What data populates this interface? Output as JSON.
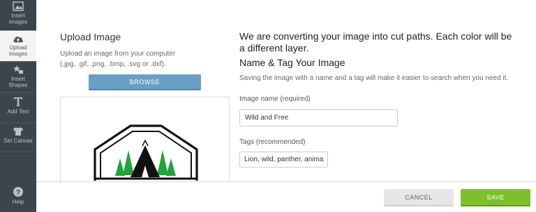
{
  "sidebar": {
    "items": [
      {
        "label": "Insert\nImages",
        "icon": "image-icon"
      },
      {
        "label": "Upload\nImages",
        "icon": "cloud-upload-icon",
        "active": true
      },
      {
        "label": "Insert\nShapes",
        "icon": "shapes-icon"
      },
      {
        "label": "Add Text",
        "icon": "text-icon"
      },
      {
        "label": "Set Canvas",
        "icon": "tshirt-icon"
      }
    ],
    "help": {
      "label": "Help",
      "icon": "help-icon"
    }
  },
  "upload": {
    "title": "Upload Image",
    "description": "Upload an image from your computer (.jpg, .gif, .png, .bmp, .svg or .dxf).",
    "browse_label": "BROWSE"
  },
  "info": {
    "converting_text": "We are converting your image into cut paths. Each color will be a different layer.",
    "tag_title": "Name & Tag Your Image",
    "tag_desc": "Saving the image with a name and a tag will make it easier to search when you need it."
  },
  "form": {
    "name_label": "Image name (required)",
    "name_value": "Wild and Free",
    "tags_label": "Tags (recommended)",
    "tags_value": "Lion, wild, panther, anima"
  },
  "footer": {
    "cancel_label": "CANCEL",
    "save_label": "SAVE"
  },
  "colors": {
    "sidebar_bg": "#3c444c",
    "browse_blue": "#6a9fc5",
    "save_green": "#7dbf2c",
    "tree_green": "#23a33c"
  }
}
